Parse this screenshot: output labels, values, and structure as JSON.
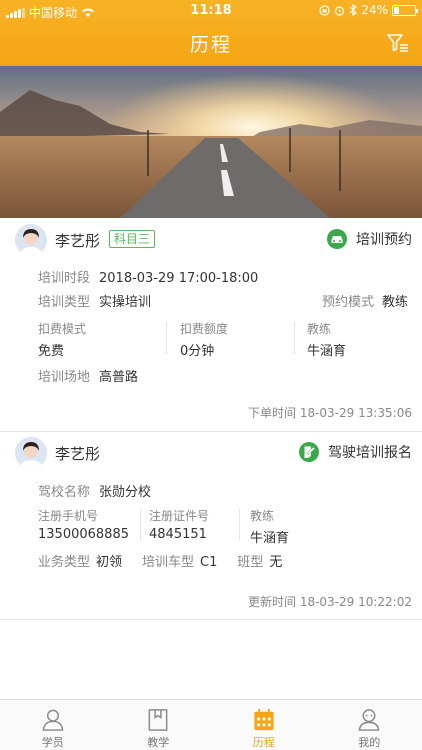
{
  "status_bar": {
    "carrier": "中国移动",
    "time": "11:18",
    "battery": "24%"
  },
  "nav": {
    "title": "历程"
  },
  "colors": {
    "accent": "#f5a514",
    "green": "#5cb85c",
    "label": "#888888"
  },
  "records": [
    {
      "name": "李艺彤",
      "subject_tag": "科目三",
      "type_label": "培训预约",
      "type_icon": "car-icon",
      "period_label": "培训时段",
      "period_value": "2018-03-29 17:00-18:00",
      "train_type_label": "培训类型",
      "train_type_value": "实操培训",
      "book_mode_label": "预约模式",
      "book_mode_value": "教练",
      "fee_mode_label": "扣费模式",
      "fee_mode_value": "免费",
      "fee_amount_label": "扣费额度",
      "fee_amount_value": "0分钟",
      "coach_label": "教练",
      "coach_value": "牛涵育",
      "site_label": "培训场地",
      "site_value": "高普路",
      "time_label": "下单时间",
      "time_value": "18-03-29 13:35:06"
    },
    {
      "name": "李艺彤",
      "type_label": "驾驶培训报名",
      "type_icon": "signup-icon",
      "school_label": "驾校名称",
      "school_value": "张勋分校",
      "phone_label": "注册手机号",
      "phone_value": "13500068885",
      "cert_label": "注册证件号",
      "cert_value": "4845151",
      "coach_label": "教练",
      "coach_value": "牛涵育",
      "biz_label": "业务类型",
      "biz_value": "初领",
      "car_label": "培训车型",
      "car_value": "C1",
      "class_label": "班型",
      "class_value": "无",
      "time_label": "更新时间",
      "time_value": "18-03-29 10:22:02"
    }
  ],
  "tabs": [
    {
      "label": "学员",
      "icon": "student-icon",
      "active": false
    },
    {
      "label": "教学",
      "icon": "teaching-icon",
      "active": false
    },
    {
      "label": "历程",
      "icon": "calendar-icon",
      "active": true
    },
    {
      "label": "我的",
      "icon": "profile-icon",
      "active": false
    }
  ]
}
